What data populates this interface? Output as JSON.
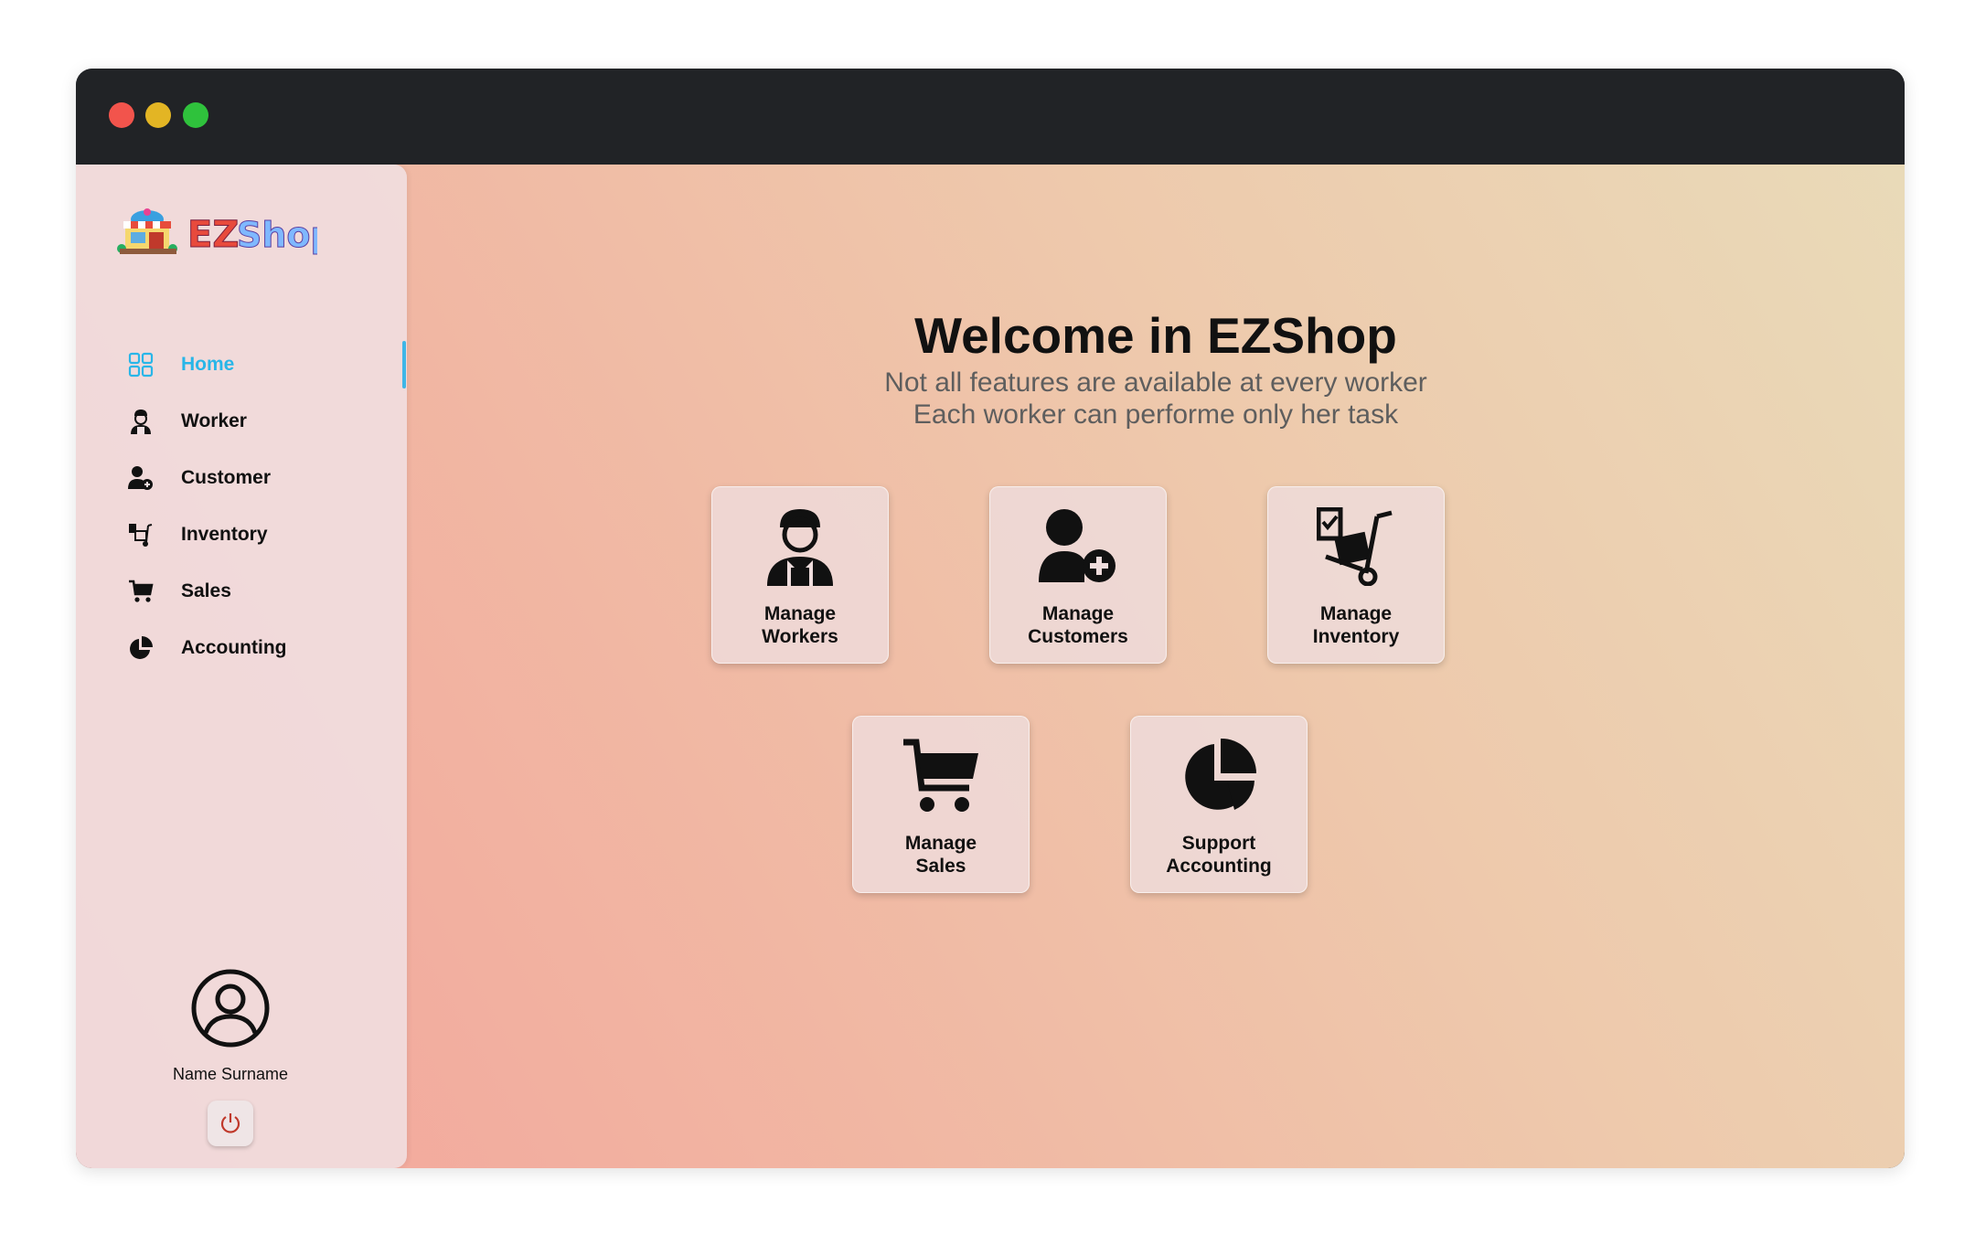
{
  "window": {
    "controls": [
      "close",
      "minimize",
      "maximize"
    ]
  },
  "sidebar": {
    "logo_text": "EZShop",
    "items": [
      {
        "label": "Home",
        "icon": "grid-icon",
        "active": true
      },
      {
        "label": "Worker",
        "icon": "worker-icon"
      },
      {
        "label": "Customer",
        "icon": "add-user-icon"
      },
      {
        "label": "Inventory",
        "icon": "hand-truck-icon"
      },
      {
        "label": "Sales",
        "icon": "cart-icon"
      },
      {
        "label": "Accounting",
        "icon": "pie-chart-icon"
      }
    ],
    "user_name": "Name Surname",
    "logout_icon": "power-icon"
  },
  "main": {
    "title": "Welcome in EZShop",
    "subtitle_line1": "Not all features are available at every worker",
    "subtitle_line2": "Each worker can performe only her task",
    "cards": [
      {
        "line1": "Manage",
        "line2": "Workers",
        "icon": "worker-icon"
      },
      {
        "line1": "Manage",
        "line2": "Customers",
        "icon": "add-user-icon"
      },
      {
        "line1": "Manage",
        "line2": "Inventory",
        "icon": "hand-truck-icon"
      },
      {
        "line1": "Manage",
        "line2": "Sales",
        "icon": "cart-icon"
      },
      {
        "line1": "Support",
        "line2": "Accounting",
        "icon": "pie-chart-icon"
      }
    ]
  },
  "colors": {
    "accent": "#29b6e8",
    "titlebar": "#212326",
    "power": "#c0392b"
  }
}
